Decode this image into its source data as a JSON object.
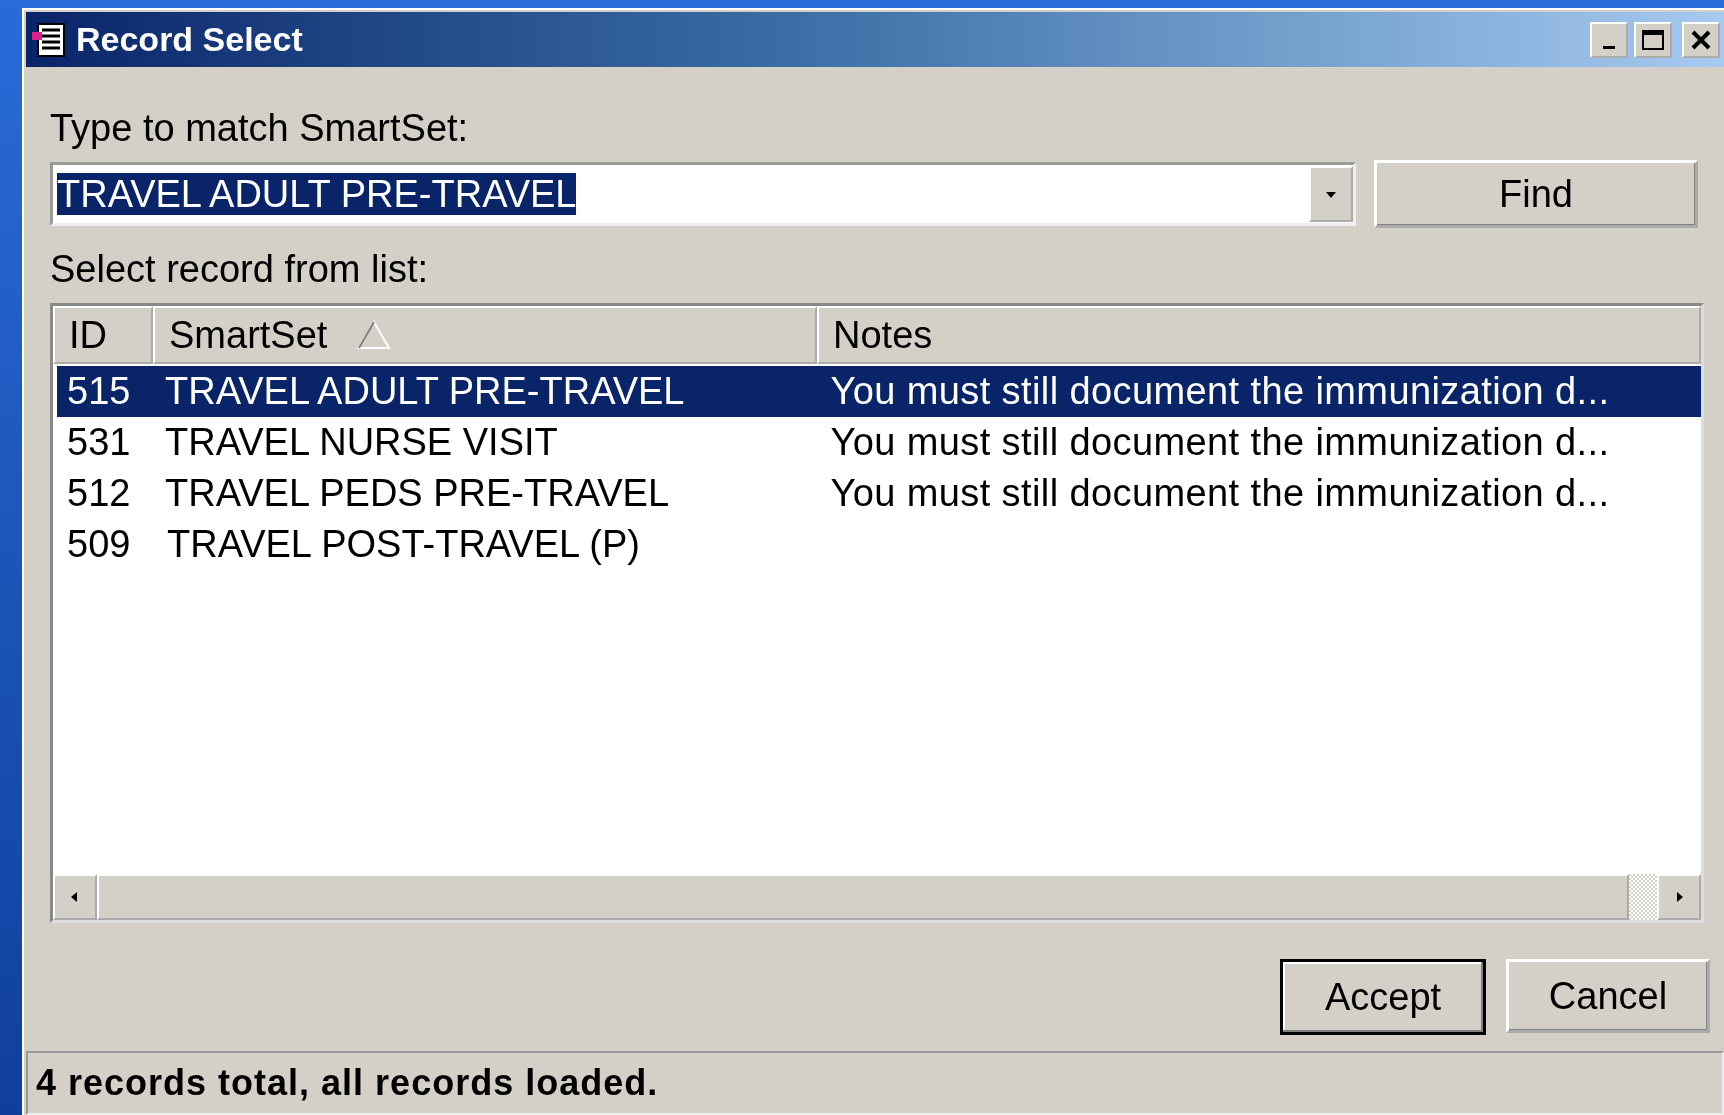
{
  "window": {
    "title": "Record Select"
  },
  "search": {
    "label": "Type to match SmartSet:",
    "value": "TRAVEL ADULT PRE-TRAVEL",
    "text_selected": true,
    "button": "Find"
  },
  "list": {
    "label": "Select record from list:",
    "columns": [
      {
        "label": "ID",
        "sorted": false
      },
      {
        "label": "SmartSet",
        "sorted": true
      },
      {
        "label": "Notes",
        "sorted": false
      }
    ],
    "rows": [
      {
        "id": "515",
        "smartset": "TRAVEL ADULT PRE-TRAVEL",
        "notes": "You must still document the immunization d...",
        "selected": true
      },
      {
        "id": "531",
        "smartset": "TRAVEL NURSE VISIT",
        "notes": "You must still document the immunization d...",
        "selected": false
      },
      {
        "id": "512",
        "smartset": "TRAVEL PEDS PRE-TRAVEL",
        "notes": "You must still document the immunization d...",
        "selected": false
      },
      {
        "id": "509",
        "smartset": "TRAVEL POST-TRAVEL (P)",
        "selected": false
      }
    ]
  },
  "buttons": [
    {
      "label": "Accept",
      "default": true
    },
    {
      "label": "Cancel",
      "default": false
    }
  ],
  "status_bar": "4 records total, all records loaded."
}
